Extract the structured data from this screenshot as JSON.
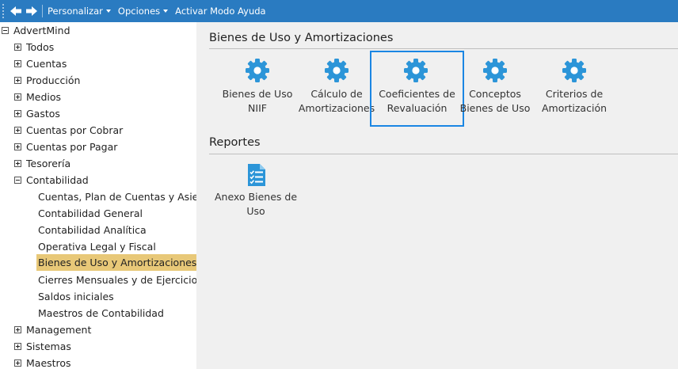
{
  "toolbar": {
    "back_icon": "arrow-left-icon",
    "forward_icon": "arrow-right-icon",
    "menus": [
      "Personalizar",
      "Opciones",
      "Activar Modo Ayuda"
    ]
  },
  "sidebar": {
    "root": "AdvertMind",
    "items": [
      "Todos",
      "Cuentas",
      "Producción",
      "Medios",
      "Gastos",
      "Cuentas por Cobrar",
      "Cuentas por Pagar",
      "Tesorería",
      "Contabilidad"
    ],
    "contabilidad_children": [
      "Cuentas, Plan de Cuentas y Asientos",
      "Contabilidad General",
      "Contabilidad Analítica",
      "Operativa Legal y Fiscal",
      "Bienes de Uso y Amortizaciones",
      "Cierres Mensuales y de Ejercicio",
      "Saldos iniciales",
      "Maestros de Contabilidad"
    ],
    "bottom_items": [
      "Management",
      "Sistemas",
      "Maestros"
    ],
    "selected": "Bienes de Uso y Amortizaciones"
  },
  "main": {
    "section_title": "Bienes de Uso y Amortizaciones",
    "tiles": [
      {
        "line1": "Bienes de Uso",
        "line2": "NIIF",
        "icon": "gear-icon"
      },
      {
        "line1": "Cálculo de",
        "line2": "Amortizaciones",
        "icon": "gear-icon"
      },
      {
        "line1": "Coeficientes de",
        "line2": "Revaluación",
        "icon": "gear-icon"
      },
      {
        "line1": "Conceptos",
        "line2": "Bienes de Uso",
        "icon": "gear-icon"
      },
      {
        "line1": "Criterios de",
        "line2": "Amortización",
        "icon": "gear-icon"
      }
    ],
    "reports_title": "Reportes",
    "reports": [
      {
        "line1": "Anexo Bienes de",
        "line2": "Uso",
        "icon": "report-document-icon"
      }
    ]
  },
  "colors": {
    "toolbar": "#2a7bc1",
    "icon_blue": "#2c95d8",
    "selected_row": "#e8c878",
    "focus_border": "#1b86e3",
    "main_bg": "#f0f0f0"
  }
}
